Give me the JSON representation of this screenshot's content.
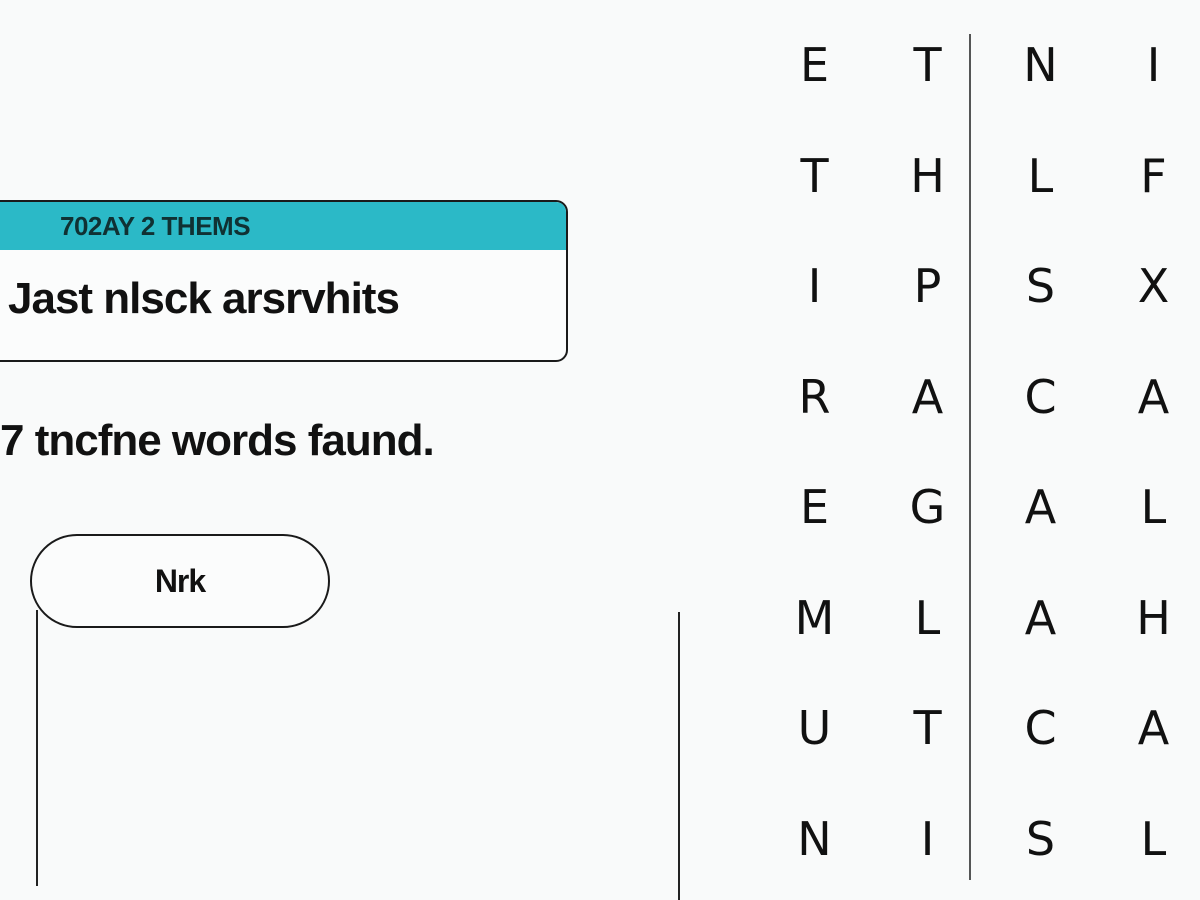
{
  "theme": {
    "header": "702AY 2 THEMS",
    "text": "Jast nlsck arsrvhits"
  },
  "status": {
    "found_text": "7 tncfne words faund."
  },
  "hint_button": {
    "label": "Nrk"
  },
  "grid": {
    "rows": [
      [
        "E",
        "T",
        "N",
        "I"
      ],
      [
        "T",
        "H",
        "L",
        "F"
      ],
      [
        "I",
        "P",
        "S",
        "X"
      ],
      [
        "R",
        "A",
        "C",
        "A"
      ],
      [
        "E",
        "G",
        "A",
        "L"
      ],
      [
        "M",
        "L",
        "A",
        "H"
      ],
      [
        "U",
        "T",
        "C",
        "A"
      ],
      [
        "N",
        "I",
        "S",
        "L"
      ]
    ]
  },
  "colors": {
    "accent": "#2bb9c7",
    "background": "#f9fafa",
    "text": "#111111"
  }
}
